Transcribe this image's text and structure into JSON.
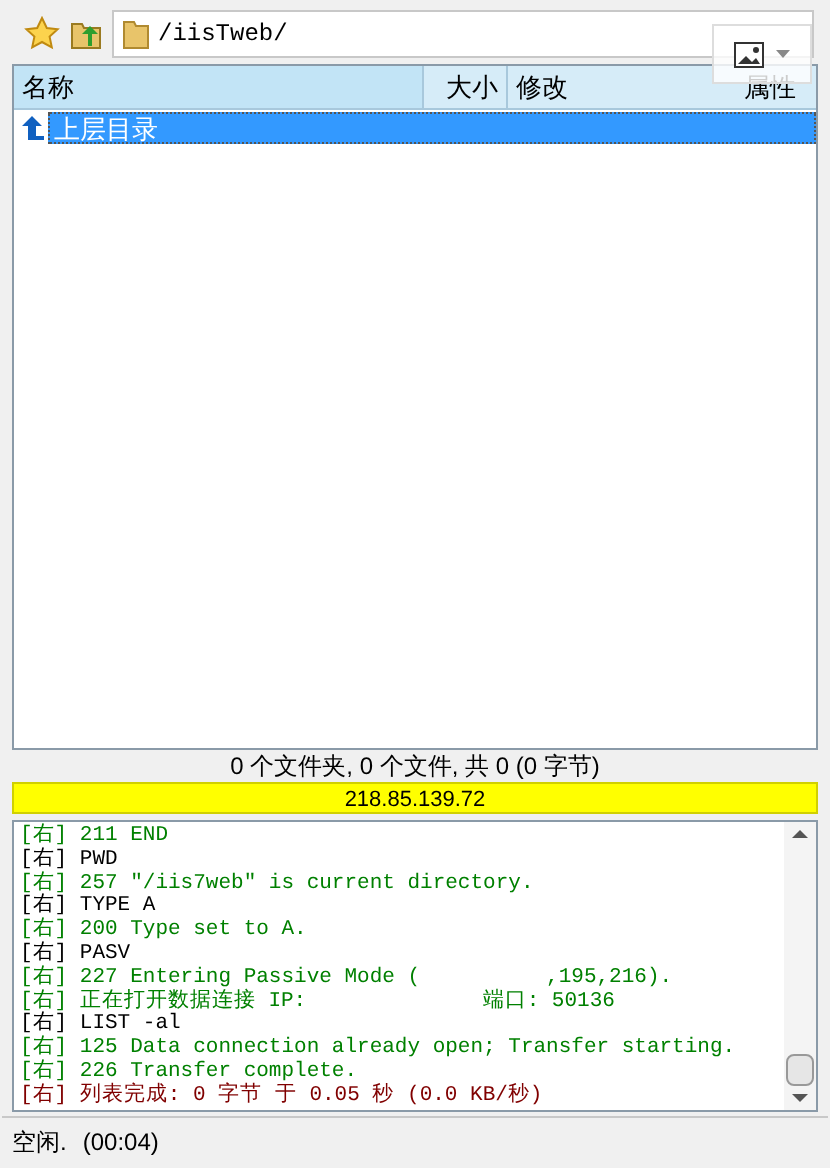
{
  "toolbar": {
    "path": "/iisTweb/"
  },
  "columns": [
    {
      "label": "名称"
    },
    {
      "label": "大小"
    },
    {
      "label": "修改"
    },
    {
      "label": "属性"
    }
  ],
  "rows": [
    {
      "name": "上层目录",
      "selected": true
    }
  ],
  "summary": "0 个文件夹, 0 个文件, 共 0 (0 字节)",
  "server": "218.85.139.72",
  "log": [
    {
      "kind": "reply",
      "text": "[右] 211 END"
    },
    {
      "kind": "command",
      "text": "[右] PWD"
    },
    {
      "kind": "reply",
      "text": "[右] 257 \"/iis7web\" is current directory."
    },
    {
      "kind": "command",
      "text": "[右] TYPE A"
    },
    {
      "kind": "reply",
      "text": "[右] 200 Type set to A."
    },
    {
      "kind": "command",
      "text": "[右] PASV"
    },
    {
      "kind": "reply",
      "text": "[右] 227 Entering Passive Mode (          ,195,216)."
    },
    {
      "kind": "reply",
      "text": "[右] 正在打开数据连接 IP:              端口: 50136"
    },
    {
      "kind": "command",
      "text": "[右] LIST -al"
    },
    {
      "kind": "reply",
      "text": "[右] 125 Data connection already open; Transfer starting."
    },
    {
      "kind": "reply",
      "text": "[右] 226 Transfer complete."
    },
    {
      "kind": "info",
      "text": "[右] 列表完成: 0 字节 于 0.05 秒 (0.0 KB/秒)"
    }
  ],
  "status": {
    "state": "空闲.",
    "time": "(00:04)"
  }
}
